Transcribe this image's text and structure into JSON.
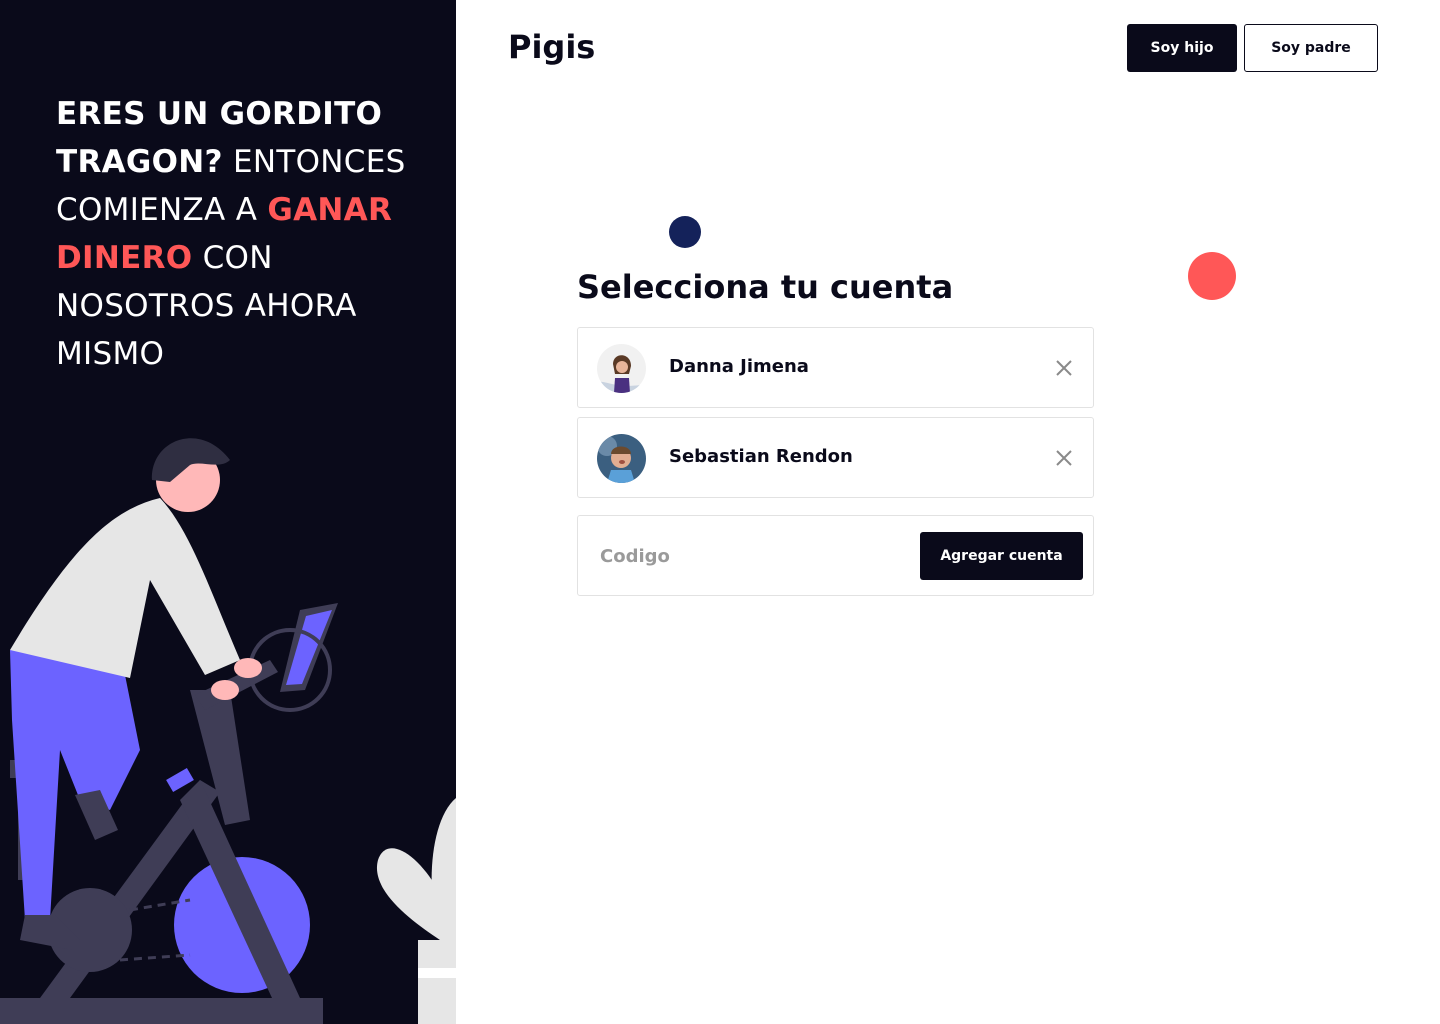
{
  "headline": {
    "part1": "ERES UN GORDITO TRAGON?",
    "part2": " ENTONCES COMIENZA A ",
    "part3": "GANAR DINERO",
    "part4": " CON NOSOTROS AHORA MISMO"
  },
  "header": {
    "brand": "Pigis",
    "btn_child": "Soy hijo",
    "btn_parent": "Soy padre"
  },
  "main": {
    "title": "Selecciona tu cuenta",
    "accounts": [
      {
        "name": "Danna Jimena"
      },
      {
        "name": "Sebastian Rendon"
      }
    ],
    "code_placeholder": "Codigo",
    "add_label": "Agregar cuenta"
  },
  "colors": {
    "dark": "#0a0a1a",
    "accent": "#ff5757",
    "navy": "#14225a",
    "purple": "#6c63ff"
  }
}
